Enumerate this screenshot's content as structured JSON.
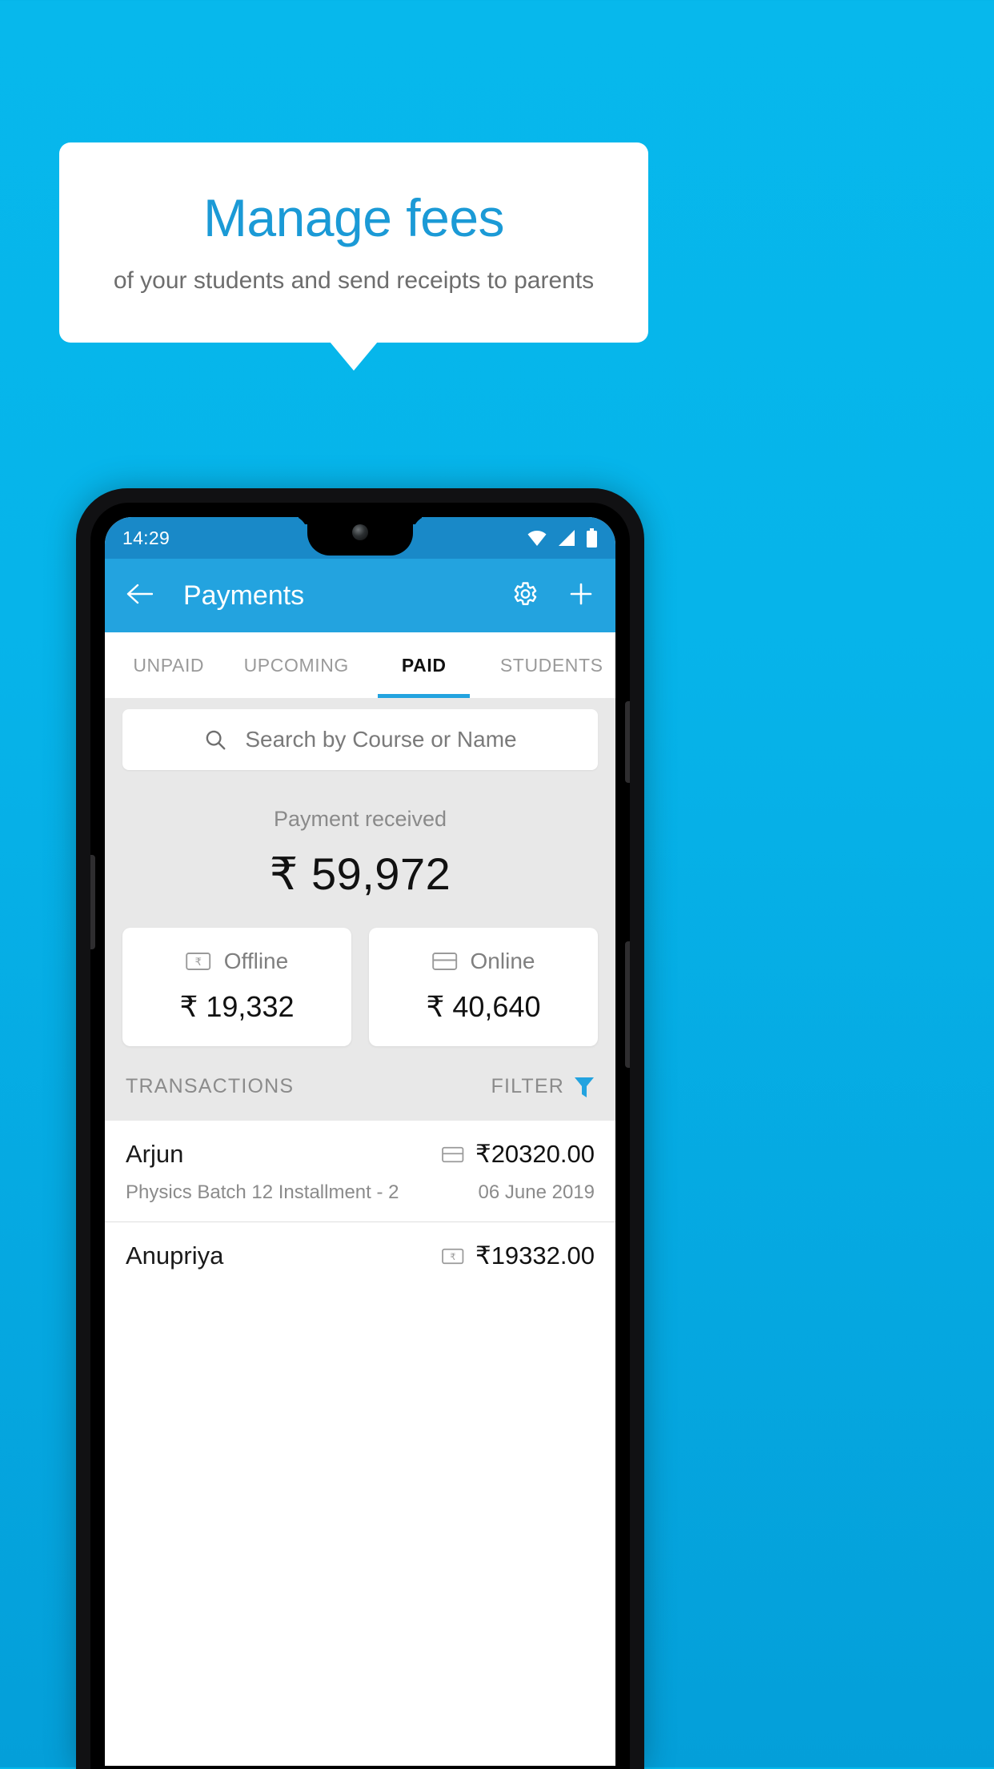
{
  "promo": {
    "title": "Manage fees",
    "subtitle": "of your students and send receipts to parents",
    "accent_color": "#1b9ad6",
    "background_color": "#06b4ea"
  },
  "phone": {
    "statusbar": {
      "time": "14:29",
      "icons": [
        "wifi-icon",
        "signal-icon",
        "battery-icon"
      ]
    },
    "appbar": {
      "back_icon": "back-arrow-icon",
      "title": "Payments",
      "settings_icon": "gear-icon",
      "add_icon": "plus-icon",
      "color": "#23a3df"
    },
    "tabs": [
      {
        "label": "UNPAID",
        "active": false
      },
      {
        "label": "UPCOMING",
        "active": false
      },
      {
        "label": "PAID",
        "active": true
      },
      {
        "label": "STUDENTS",
        "active": false
      }
    ],
    "search": {
      "placeholder": "Search by Course or Name",
      "icon": "search-icon"
    },
    "summary": {
      "label": "Payment received",
      "amount": "₹ 59,972"
    },
    "mode_cards": [
      {
        "label": "Offline",
        "amount": "₹ 19,332",
        "icon": "rupee-note-icon"
      },
      {
        "label": "Online",
        "amount": "₹ 40,640",
        "icon": "credit-card-icon"
      }
    ],
    "transactions_header": {
      "title": "TRANSACTIONS",
      "filter_label": "FILTER",
      "filter_icon": "funnel-icon",
      "filter_icon_color": "#23a3df"
    },
    "transactions": [
      {
        "name": "Arjun",
        "amount": "₹20320.00",
        "icon": "credit-card-icon",
        "description": "Physics Batch 12 Installment - 2",
        "date": "06 June 2019"
      },
      {
        "name": "Anupriya",
        "amount": "₹19332.00",
        "icon": "rupee-note-icon",
        "description": "",
        "date": ""
      }
    ]
  }
}
